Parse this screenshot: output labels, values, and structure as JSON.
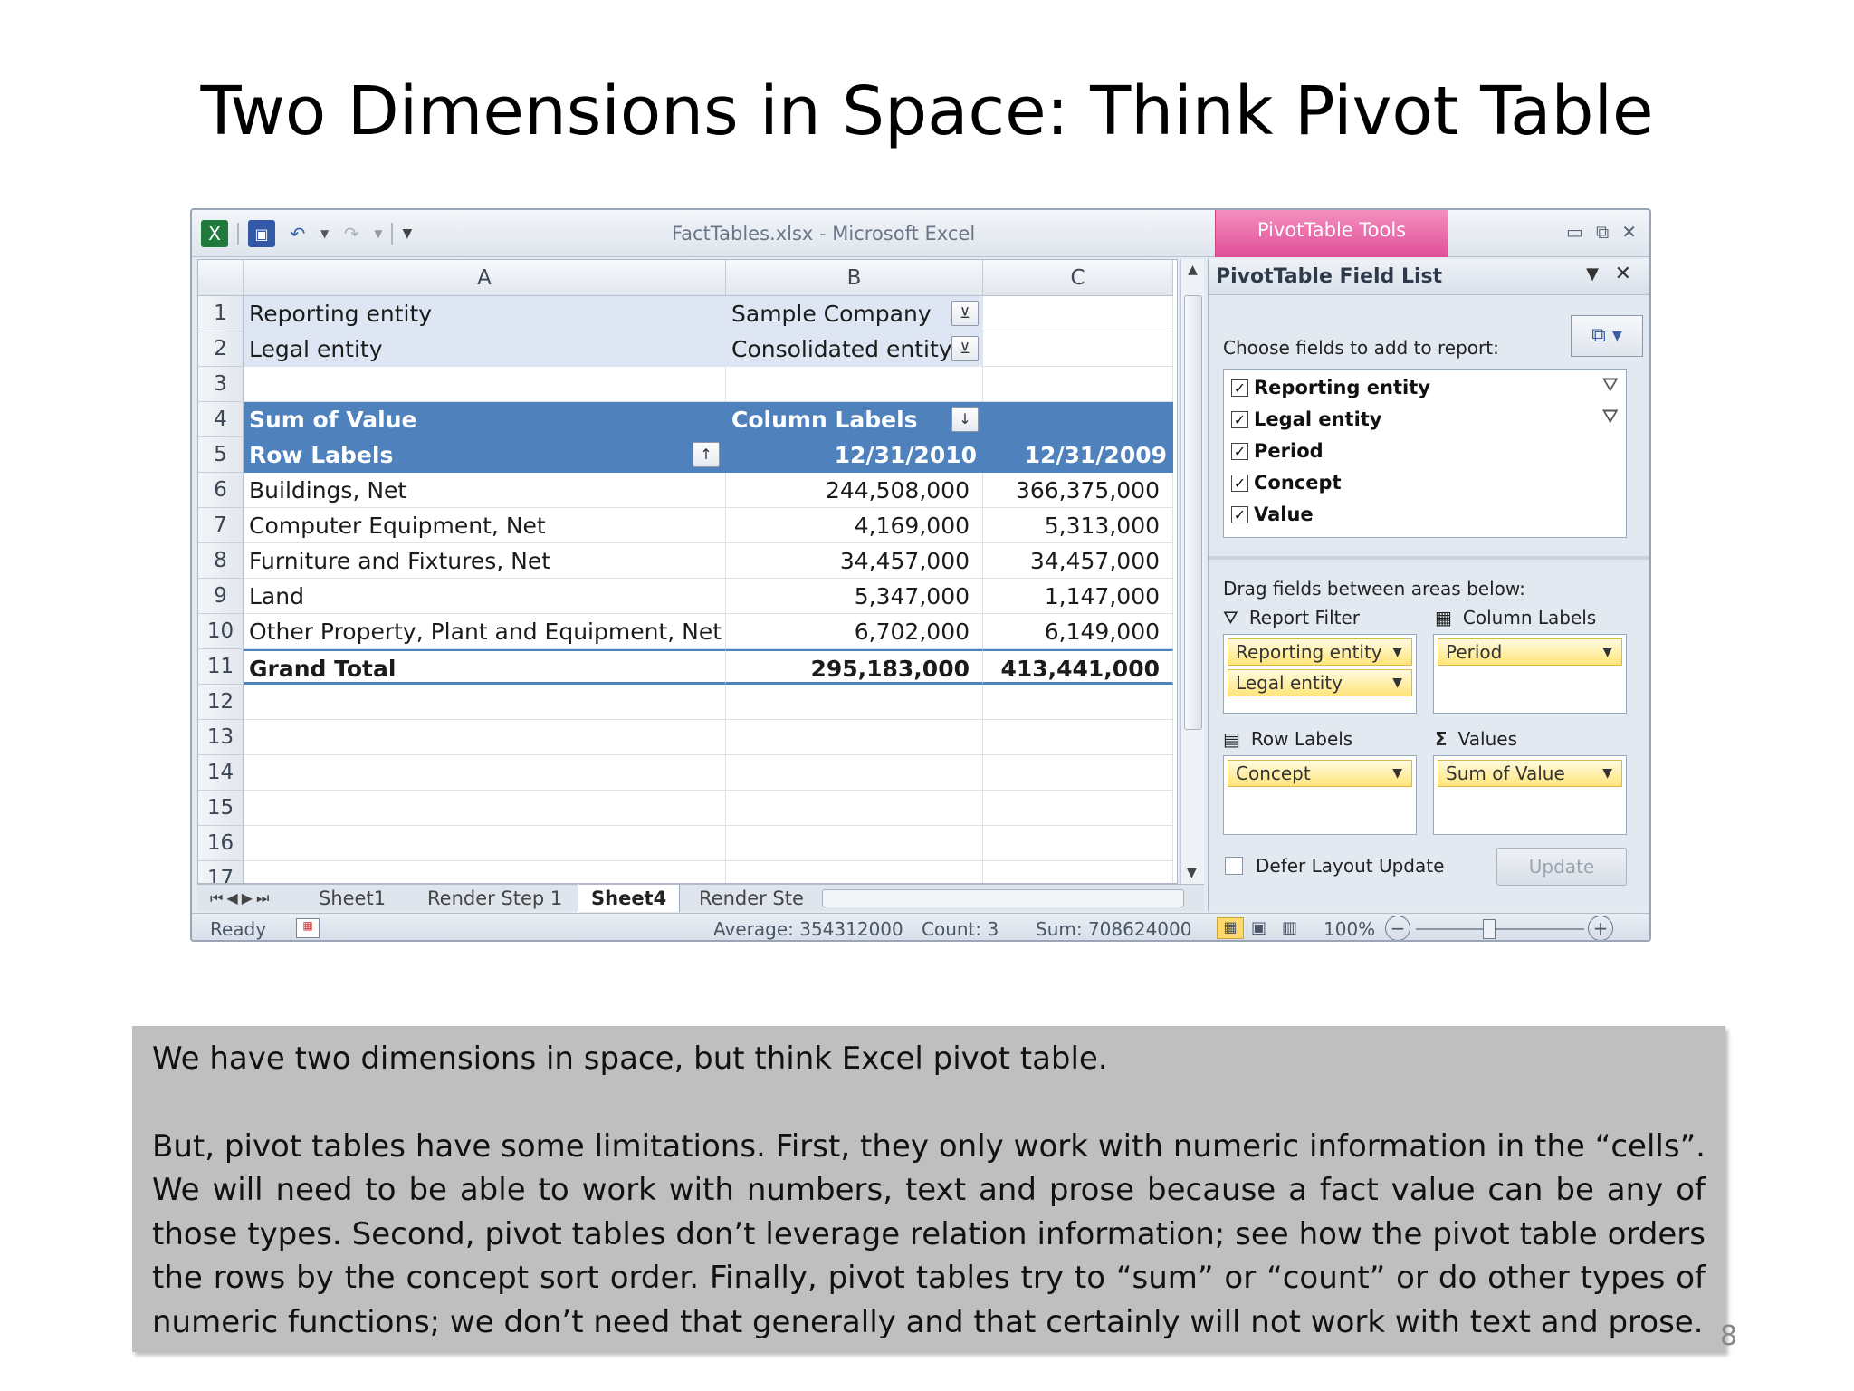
{
  "slide": {
    "title": "Two Dimensions in Space: Think Pivot Table",
    "page_number": "8"
  },
  "window": {
    "title": "FactTables.xlsx  -  Microsoft Excel",
    "contextual_tab": "PivotTable Tools",
    "colors": {
      "pivot_header": "#4f81bd",
      "filter_rows": "#dde6f2",
      "contextual": "#e05a9f"
    }
  },
  "grid": {
    "columns": [
      "A",
      "B",
      "C"
    ],
    "row_numbers": [
      "1",
      "2",
      "3",
      "4",
      "5",
      "6",
      "7",
      "8",
      "9",
      "10",
      "11",
      "12",
      "13",
      "14",
      "15",
      "16",
      "17"
    ],
    "filters": [
      {
        "label": "Reporting entity",
        "value": "Sample Company"
      },
      {
        "label": "Legal entity",
        "value": "Consolidated entity"
      }
    ],
    "pivot_header": {
      "sum_label": "Sum of Value",
      "column_labels": "Column Labels",
      "row_labels": "Row Labels",
      "periods": [
        "12/31/2010",
        "12/31/2009"
      ]
    },
    "rows": [
      {
        "label": "Buildings, Net",
        "v2010": "244,508,000",
        "v2009": "366,375,000"
      },
      {
        "label": "Computer Equipment, Net",
        "v2010": "4,169,000",
        "v2009": "5,313,000"
      },
      {
        "label": "Furniture and Fixtures, Net",
        "v2010": "34,457,000",
        "v2009": "34,457,000"
      },
      {
        "label": "Land",
        "v2010": "5,347,000",
        "v2009": "1,147,000"
      },
      {
        "label": "Other Property, Plant and Equipment, Net",
        "v2010": "6,702,000",
        "v2009": "6,149,000"
      }
    ],
    "grand_total": {
      "label": "Grand Total",
      "v2010": "295,183,000",
      "v2009": "413,441,000"
    }
  },
  "sheet_tabs": [
    "Sheet1",
    "Render Step 1",
    "Sheet4",
    "Render Ste"
  ],
  "status_bar": {
    "ready": "Ready",
    "average": "Average: 354312000",
    "count": "Count: 3",
    "sum": "Sum: 708624000",
    "zoom": "100%"
  },
  "field_list": {
    "title": "PivotTable Field List",
    "choose_label": "Choose fields to add to report:",
    "fields": [
      {
        "name": "Reporting entity",
        "checked": true,
        "filtered": true
      },
      {
        "name": "Legal entity",
        "checked": true,
        "filtered": true
      },
      {
        "name": "Period",
        "checked": true,
        "filtered": false
      },
      {
        "name": "Concept",
        "checked": true,
        "filtered": false
      },
      {
        "name": "Value",
        "checked": true,
        "filtered": false
      }
    ],
    "drag_label": "Drag fields between areas below:",
    "areas": {
      "report_filter": {
        "title": "Report Filter",
        "items": [
          "Reporting entity",
          "Legal entity"
        ]
      },
      "column_labels": {
        "title": "Column Labels",
        "items": [
          "Period"
        ]
      },
      "row_labels": {
        "title": "Row Labels",
        "items": [
          "Concept"
        ]
      },
      "values": {
        "title": "Values",
        "items": [
          "Sum of Value"
        ]
      }
    },
    "defer_label": "Defer Layout Update",
    "update_label": "Update"
  },
  "caption": {
    "line1": "We have two dimensions in space, but think Excel pivot table.",
    "para2": "But, pivot tables have some limitations.  First, they only work with numeric information in the “cells”.  We will need to be able to work with numbers, text and prose because a fact value can be any of those types.  Second, pivot tables don’t leverage relation information; see how the pivot table orders the rows by the concept sort order.  Finally, pivot tables try to “sum” or “count” or do other types of numeric functions;  we don’t need that generally and that certainly will not work with text and prose."
  }
}
